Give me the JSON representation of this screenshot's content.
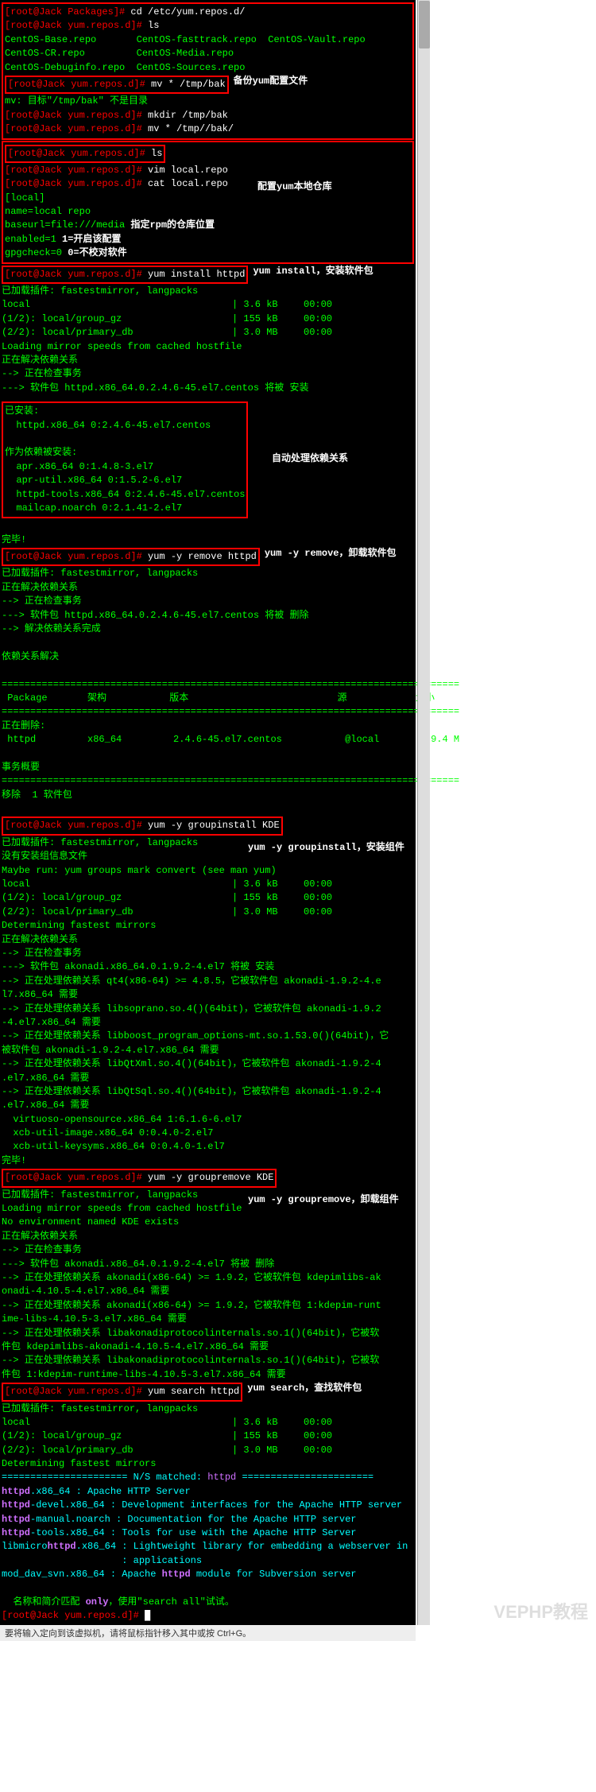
{
  "section1": {
    "p1": "[root@Jack Packages]#",
    "c1": " cd /etc/yum.repos.d/",
    "p2": "[root@Jack yum.repos.d]#",
    "c2": " ls",
    "l1": "CentOS-Base.repo       CentOS-fasttrack.repo  CentOS-Vault.repo",
    "l2": "CentOS-CR.repo         CentOS-Media.repo",
    "l3": "CentOS-Debuginfo.repo  CentOS-Sources.repo",
    "p3": "[root@Jack yum.repos.d]#",
    "c3": " mv * /tmp/bak",
    "note1": "备份yum配置文件",
    "l4": "mv: 目标\"/tmp/bak\" 不是目录",
    "p4": "[root@Jack yum.repos.d]#",
    "c4": " mkdir /tmp/bak",
    "p5": "[root@Jack yum.repos.d]#",
    "c5": " mv * /tmp//bak/"
  },
  "section2": {
    "p1": "[root@Jack yum.repos.d]#",
    "c1": " ls",
    "p2": "[root@Jack yum.repos.d]#",
    "c2": " vim local.repo",
    "p3": "[root@Jack yum.repos.d]#",
    "c3": " cat local.repo",
    "note1": "配置yum本地仓库",
    "f1": "[local]",
    "f2": "name=local repo",
    "f3a": "baseurl=file:///media",
    "f3note": "指定rpm的仓库位置",
    "f4a": "enabled=1 ",
    "f4note": "1=开启该配置",
    "f5a": "gpgcheck=0 ",
    "f5note": "0=不校对软件"
  },
  "section3": {
    "p1": "[root@Jack yum.repos.d]#",
    "c1": " yum install httpd",
    "note1": "yum install，安装软件包",
    "l1": "已加载插件: fastestmirror, langpacks",
    "t1a": "local",
    "t1b": "| 3.6 kB",
    "t1c": "00:00",
    "t2a": "(1/2): local/group_gz",
    "t2b": "| 155 kB",
    "t2c": "00:00",
    "t3a": "(2/2): local/primary_db",
    "t3b": "| 3.0 MB",
    "t3c": "00:00",
    "l2": "Loading mirror speeds from cached hostfile",
    "l3": "正在解决依赖关系",
    "l4": "--> 正在检查事务",
    "l5": "---> 软件包 httpd.x86_64.0.2.4.6-45.el7.centos 将被 安装"
  },
  "section4": {
    "note1": "自动处理依赖关系",
    "h1": "已安装:",
    "l1": "  httpd.x86_64 0:2.4.6-45.el7.centos",
    "h2": "作为依赖被安装:",
    "d1": "  apr.x86_64 0:1.4.8-3.el7",
    "d2": "  apr-util.x86_64 0:1.5.2-6.el7",
    "d3": "  httpd-tools.x86_64 0:2.4.6-45.el7.centos",
    "d4": "  mailcap.noarch 0:2.1.41-2.el7"
  },
  "section5": {
    "done": "完毕!",
    "p1": "[root@Jack yum.repos.d]#",
    "c1": " yum -y remove httpd",
    "note1": "yum -y remove，卸载软件包",
    "l1": "已加载插件: fastestmirror, langpacks",
    "l2": "正在解决依赖关系",
    "l3": "--> 正在检查事务",
    "l4": "---> 软件包 httpd.x86_64.0.2.4.6-45.el7.centos 将被 删除",
    "l5": "--> 解决依赖关系完成",
    "h1": "依赖关系解决",
    "sep": "================================================================================",
    "th": " Package       架构           版本                          源            大小",
    "rm": "正在删除:",
    "pk": " httpd         x86_64         2.4.6-45.el7.centos           @local         9.4 M",
    "ts": "事务概要",
    "rmc": "移除  1 软件包"
  },
  "section6": {
    "p1": "[root@Jack yum.repos.d]#",
    "c1": " yum -y groupinstall KDE",
    "note1": "yum -y groupinstall，安装组件",
    "l1": "已加载插件: fastestmirror, langpacks",
    "l2": "没有安装组信息文件",
    "l3": "Maybe run: yum groups mark convert (see man yum)",
    "t1a": "local",
    "t1b": "| 3.6 kB",
    "t1c": "00:00",
    "t2a": "(1/2): local/group_gz",
    "t2b": "| 155 kB",
    "t2c": "00:00",
    "t3a": "(2/2): local/primary_db",
    "t3b": "| 3.0 MB",
    "t3c": "00:00",
    "l4": "Determining fastest mirrors",
    "l5": "正在解决依赖关系",
    "l6": "--> 正在检查事务",
    "l7": "---> 软件包 akonadi.x86_64.0.1.9.2-4.el7 将被 安装",
    "l8": "--> 正在处理依赖关系 qt4(x86-64) >= 4.8.5，它被软件包 akonadi-1.9.2-4.e",
    "l8b": "l7.x86_64 需要",
    "l9": "--> 正在处理依赖关系 libsoprano.so.4()(64bit)，它被软件包 akonadi-1.9.2",
    "l9b": "-4.el7.x86_64 需要",
    "l10": "--> 正在处理依赖关系 libboost_program_options-mt.so.1.53.0()(64bit)，它",
    "l10b": "被软件包 akonadi-1.9.2-4.el7.x86_64 需要",
    "l11": "--> 正在处理依赖关系 libQtXml.so.4()(64bit)，它被软件包 akonadi-1.9.2-4",
    "l11b": ".el7.x86_64 需要",
    "l12": "--> 正在处理依赖关系 libQtSql.so.4()(64bit)，它被软件包 akonadi-1.9.2-4",
    "l12b": ".el7.x86_64 需要",
    "d1": "  virtuoso-opensource.x86_64 1:6.1.6-6.el7",
    "d2": "  xcb-util-image.x86_64 0:0.4.0-2.el7",
    "d3": "  xcb-util-keysyms.x86_64 0:0.4.0-1.el7",
    "done": "完毕!"
  },
  "section7": {
    "p1": "[root@Jack yum.repos.d]#",
    "c1": " yum -y groupremove KDE",
    "note1": "yum -y groupremove，卸载组件",
    "l1": "已加载插件: fastestmirror, langpacks",
    "l2": "Loading mirror speeds from cached hostfile",
    "l3": "No environment named KDE exists",
    "l4": "正在解决依赖关系",
    "l5": "--> 正在检查事务",
    "l6": "---> 软件包 akonadi.x86_64.0.1.9.2-4.el7 将被 删除",
    "l7": "--> 正在处理依赖关系 akonadi(x86-64) >= 1.9.2，它被软件包 kdepimlibs-ak",
    "l7b": "onadi-4.10.5-4.el7.x86_64 需要",
    "l8": "--> 正在处理依赖关系 akonadi(x86-64) >= 1.9.2，它被软件包 1:kdepim-runt",
    "l8b": "ime-libs-4.10.5-3.el7.x86_64 需要",
    "l9": "--> 正在处理依赖关系 libakonadiprotocolinternals.so.1()(64bit)，它被软",
    "l9b": "件包 kdepimlibs-akonadi-4.10.5-4.el7.x86_64 需要",
    "l10": "--> 正在处理依赖关系 libakonadiprotocolinternals.so.1()(64bit)，它被软",
    "l10b": "件包 1:kdepim-runtime-libs-4.10.5-3.el7.x86_64 需要"
  },
  "section8": {
    "p1": "[root@Jack yum.repos.d]#",
    "c1": " yum search httpd",
    "note1": "yum search，查找软件包",
    "l1": "已加载插件: fastestmirror, langpacks",
    "t1a": "local",
    "t1b": "| 3.6 kB",
    "t1c": "00:00",
    "t2a": "(1/2): local/group_gz",
    "t2b": "| 155 kB",
    "t2c": "00:00",
    "t3a": "(2/2): local/primary_db",
    "t3b": "| 3.0 MB",
    "t3c": "00:00",
    "l2": "Determining fastest mirrors",
    "sep": "====================== N/S matched: ",
    "sepb": "httpd",
    "sepc": " =======================",
    "r1a": "httpd",
    "r1b": ".x86_64 : Apache HTTP Server",
    "r2a": "httpd",
    "r2b": "-devel.x86_64 : Development interfaces for the Apache HTTP server",
    "r3a": "httpd",
    "r3b": "-manual.noarch : Documentation for the Apache HTTP server",
    "r4a": "httpd",
    "r4b": "-tools.x86_64 : Tools for use with the Apache HTTP Server",
    "r5a": "libmicro",
    "r5a2": "httpd",
    "r5b": ".x86_64 : Lightweight library for embedding a webserver in",
    "r5c": "                     : applications",
    "r6a": "mod_dav_svn.x86_64 : Apache ",
    "r6a2": "httpd",
    "r6b": " module for Subversion server",
    "hint": "  名称和简介匹配 ",
    "hint2": "only",
    "hint3": "，使用\"search all\"试试。",
    "p2": "[root@Jack yum.repos.d]#",
    "c2": " "
  },
  "watermark": "VEPHP教程",
  "statusbar": "要将输入定向到该虚拟机，请将鼠标指针移入其中或按 Ctrl+G。"
}
